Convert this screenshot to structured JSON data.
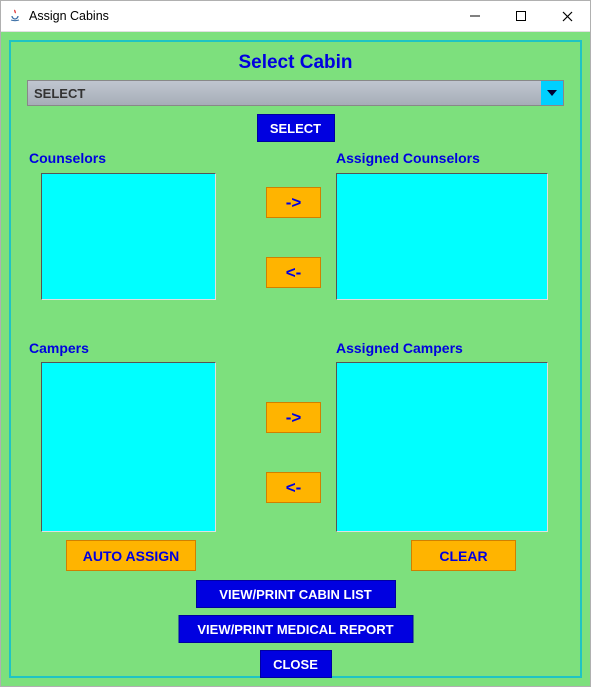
{
  "window": {
    "title": "Assign Cabins"
  },
  "header": "Select Cabin",
  "combo": {
    "selected": "SELECT"
  },
  "buttons": {
    "select": "SELECT",
    "arrow_right": "->",
    "arrow_left": "<-",
    "auto_assign": "AUTO ASSIGN",
    "clear": "CLEAR",
    "view_cabin": "VIEW/PRINT CABIN LIST",
    "view_medical": "VIEW/PRINT MEDICAL REPORT",
    "close": "CLOSE"
  },
  "labels": {
    "counselors": "Counselors",
    "assigned_counselors": "Assigned Counselors",
    "campers": "Campers",
    "assigned_campers": "Assigned Campers"
  },
  "lists": {
    "counselors": [],
    "assigned_counselors": [],
    "campers": [],
    "assigned_campers": []
  },
  "colors": {
    "panel_bg": "#7de07d",
    "list_bg": "#00ffff",
    "blue": "#0000e0",
    "orange": "#ffb400"
  }
}
